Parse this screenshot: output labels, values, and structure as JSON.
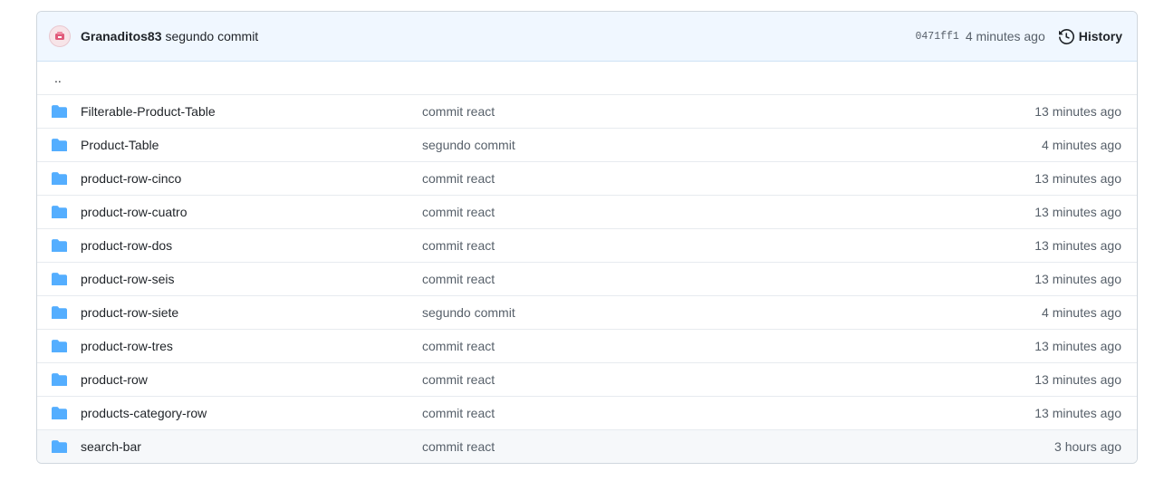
{
  "commit": {
    "author": "Granaditos83",
    "message": "segundo commit",
    "sha": "0471ff1",
    "age": "4 minutes ago",
    "history_label": "History"
  },
  "parent_link": "..",
  "files": [
    {
      "name": "Filterable-Product-Table",
      "message": "commit react",
      "age": "13 minutes ago"
    },
    {
      "name": "Product-Table",
      "message": "segundo commit",
      "age": "4 minutes ago"
    },
    {
      "name": "product-row-cinco",
      "message": "commit react",
      "age": "13 minutes ago"
    },
    {
      "name": "product-row-cuatro",
      "message": "commit react",
      "age": "13 minutes ago"
    },
    {
      "name": "product-row-dos",
      "message": "commit react",
      "age": "13 minutes ago"
    },
    {
      "name": "product-row-seis",
      "message": "commit react",
      "age": "13 minutes ago"
    },
    {
      "name": "product-row-siete",
      "message": "segundo commit",
      "age": "4 minutes ago"
    },
    {
      "name": "product-row-tres",
      "message": "commit react",
      "age": "13 minutes ago"
    },
    {
      "name": "product-row",
      "message": "commit react",
      "age": "13 minutes ago"
    },
    {
      "name": "products-category-row",
      "message": "commit react",
      "age": "13 minutes ago"
    },
    {
      "name": "search-bar",
      "message": "commit react",
      "age": "3 hours ago"
    }
  ],
  "colors": {
    "folder": "#54aeff",
    "commit_bar_bg": "#f0f7ff"
  },
  "icons": {
    "folder": "folder-icon",
    "history": "history-icon"
  }
}
